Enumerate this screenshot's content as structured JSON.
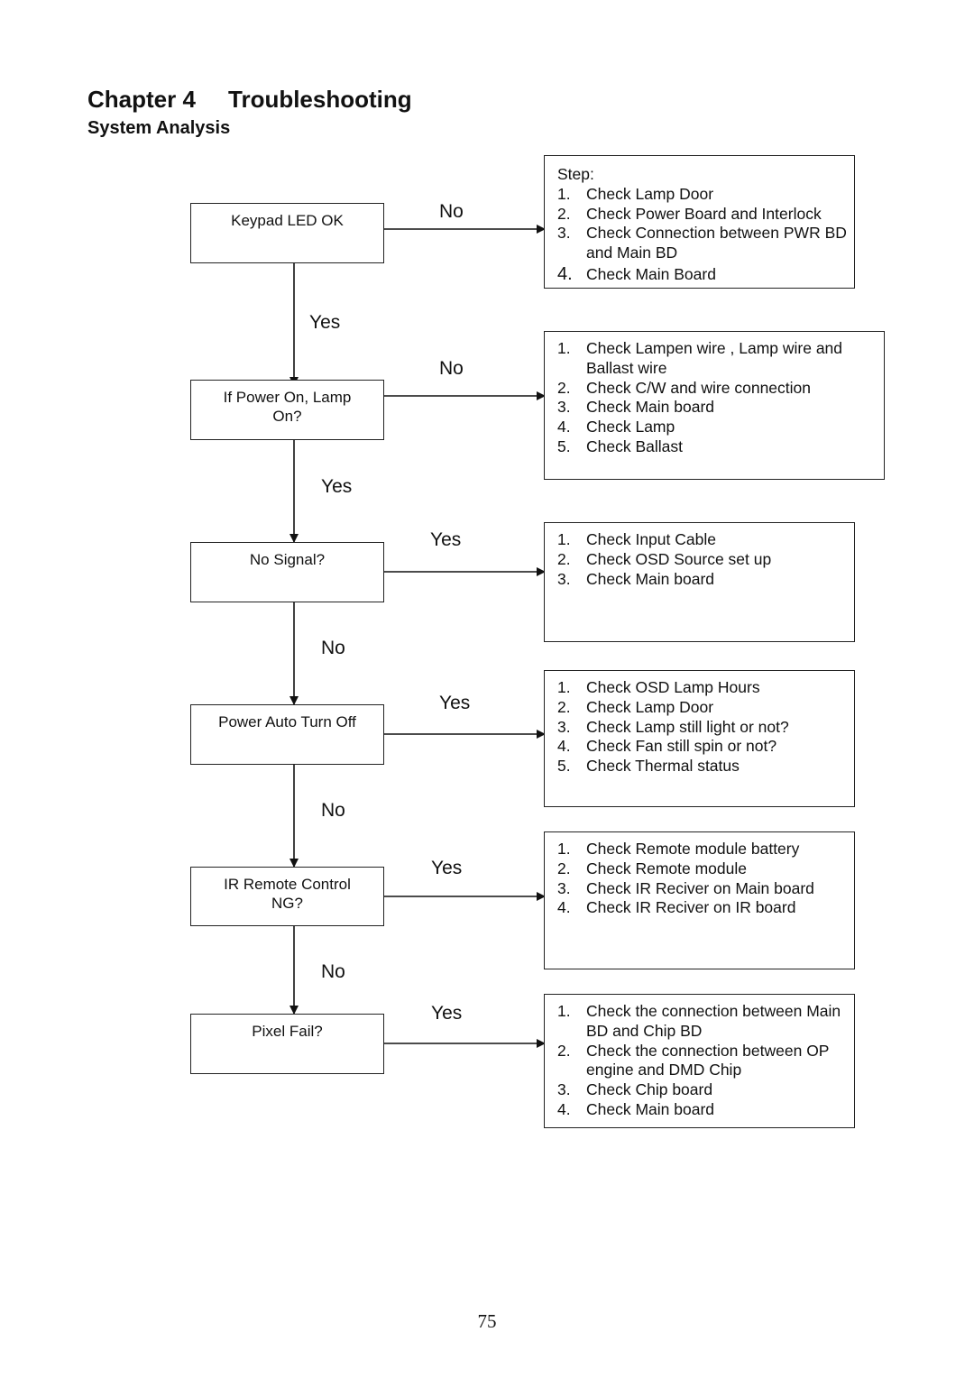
{
  "header": {
    "chapter_label": "Chapter 4",
    "chapter_title": "Troubleshooting",
    "section_title": "System Analysis"
  },
  "flow": {
    "decisions": [
      {
        "id": "keypad-led",
        "text": "Keypad LED OK",
        "down_label": "Yes",
        "right_label": "No"
      },
      {
        "id": "power-lamp",
        "text": "If Power On, Lamp On?",
        "down_label": "Yes",
        "right_label": "No"
      },
      {
        "id": "no-signal",
        "text": "No Signal?",
        "down_label": "No",
        "right_label": "Yes"
      },
      {
        "id": "power-auto-off",
        "text": "Power Auto Turn Off",
        "down_label": "No",
        "right_label": "Yes"
      },
      {
        "id": "ir-remote",
        "text": "IR Remote Control NG?",
        "down_label": "No",
        "right_label": "Yes"
      },
      {
        "id": "pixel-fail",
        "text": "Pixel Fail?",
        "down_label": "",
        "right_label": "Yes"
      }
    ],
    "actions": [
      {
        "heading": "Step:",
        "items": [
          {
            "n": "1.",
            "text": "Check Lamp Door"
          },
          {
            "n": "2.",
            "text": "Check Power Board and Interlock"
          },
          {
            "n": "3.",
            "text": "Check Connection between PWR BD and Main BD"
          },
          {
            "n": "4.",
            "text": "Check Main Board"
          }
        ]
      },
      {
        "heading": "",
        "items": [
          {
            "n": "1.",
            "text": "Check Lampen wire , Lamp wire and Ballast wire"
          },
          {
            "n": "2.",
            "text": "Check C/W and wire connection"
          },
          {
            "n": "3.",
            "text": "Check Main board"
          },
          {
            "n": "4.",
            "text": "Check Lamp"
          },
          {
            "n": "5.",
            "text": "Check Ballast"
          }
        ]
      },
      {
        "heading": "",
        "items": [
          {
            "n": "1.",
            "text": "Check Input Cable"
          },
          {
            "n": "2.",
            "text": "Check OSD Source set up"
          },
          {
            "n": "3.",
            "text": "Check Main board"
          }
        ]
      },
      {
        "heading": "",
        "items": [
          {
            "n": "1.",
            "text": "Check OSD Lamp Hours"
          },
          {
            "n": "2.",
            "text": "Check Lamp Door"
          },
          {
            "n": "3.",
            "text": "Check Lamp still light or not?"
          },
          {
            "n": "4.",
            "text": "Check Fan still spin or not?"
          },
          {
            "n": "5.",
            "text": "Check Thermal status"
          }
        ]
      },
      {
        "heading": "",
        "items": [
          {
            "n": "1.",
            "text": "Check Remote module battery"
          },
          {
            "n": "2.",
            "text": "Check Remote module"
          },
          {
            "n": "3.",
            "text": "Check IR Reciver on Main board"
          },
          {
            "n": "4.",
            "text": "Check IR Reciver on IR board"
          }
        ]
      },
      {
        "heading": "",
        "items": [
          {
            "n": "1.",
            "text": "Check the connection between Main BD and Chip BD"
          },
          {
            "n": "2.",
            "text": "Check the connection between OP engine and DMD Chip"
          },
          {
            "n": "3.",
            "text": "Check Chip board"
          },
          {
            "n": "4.",
            "text": "Check Main board"
          }
        ]
      }
    ]
  },
  "footer": {
    "page_number": "75"
  }
}
